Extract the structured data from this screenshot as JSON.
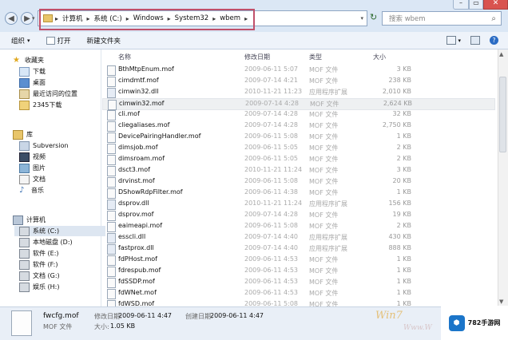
{
  "address": {
    "crumbs": [
      "计算机",
      "系统 (C:)",
      "Windows",
      "System32",
      "wbem"
    ],
    "refresh": "↻"
  },
  "search": {
    "placeholder": "搜索 wbem"
  },
  "toolbar": {
    "organize": "组织",
    "open": "打开",
    "new_folder": "新建文件夹"
  },
  "nav": {
    "favorites": {
      "title": "收藏夹",
      "items": [
        "下载",
        "桌面",
        "最近访问的位置",
        "2345下载"
      ]
    },
    "library": {
      "title": "库",
      "items": [
        "Subversion",
        "视频",
        "图片",
        "文档",
        "音乐"
      ]
    },
    "computer": {
      "title": "计算机",
      "items": [
        "系统 (C:)",
        "本地磁盘 (D:)",
        "软件 (E:)",
        "软件 (F:)",
        "文档 (G:)",
        "娱乐 (H:)"
      ]
    }
  },
  "columns": {
    "name": "名称",
    "date": "修改日期",
    "type": "类型",
    "size": "大小"
  },
  "files": [
    {
      "name": "BthMtpEnum.mof",
      "date": "2009-06-11 5:07",
      "type": "MOF 文件",
      "size": "3 KB"
    },
    {
      "name": "cimdmtf.mof",
      "date": "2009-07-14 4:21",
      "type": "MOF 文件",
      "size": "238 KB"
    },
    {
      "name": "cimwin32.dll",
      "date": "2010-11-21 11:23",
      "type": "应用程序扩展",
      "size": "2,010 KB"
    },
    {
      "name": "cimwin32.mof",
      "date": "2009-07-14 4:28",
      "type": "MOF 文件",
      "size": "2,624 KB"
    },
    {
      "name": "cli.mof",
      "date": "2009-07-14 4:28",
      "type": "MOF 文件",
      "size": "32 KB"
    },
    {
      "name": "cliegaliases.mof",
      "date": "2009-07-14 4:28",
      "type": "MOF 文件",
      "size": "2,750 KB"
    },
    {
      "name": "DevicePairingHandler.mof",
      "date": "2009-06-11 5:08",
      "type": "MOF 文件",
      "size": "1 KB"
    },
    {
      "name": "dimsjob.mof",
      "date": "2009-06-11 5:05",
      "type": "MOF 文件",
      "size": "2 KB"
    },
    {
      "name": "dimsroam.mof",
      "date": "2009-06-11 5:05",
      "type": "MOF 文件",
      "size": "2 KB"
    },
    {
      "name": "dsct3.mof",
      "date": "2010-11-21 11:24",
      "type": "MOF 文件",
      "size": "3 KB"
    },
    {
      "name": "drvinst.mof",
      "date": "2009-06-11 5:08",
      "type": "MOF 文件",
      "size": "20 KB"
    },
    {
      "name": "DShowRdpFilter.mof",
      "date": "2009-06-11 4:38",
      "type": "MOF 文件",
      "size": "1 KB"
    },
    {
      "name": "dsprov.dll",
      "date": "2010-11-21 11:24",
      "type": "应用程序扩展",
      "size": "156 KB"
    },
    {
      "name": "dsprov.mof",
      "date": "2009-07-14 4:28",
      "type": "MOF 文件",
      "size": "19 KB"
    },
    {
      "name": "eaimeapi.mof",
      "date": "2009-06-11 5:08",
      "type": "MOF 文件",
      "size": "2 KB"
    },
    {
      "name": "esscli.dll",
      "date": "2009-07-14 4:40",
      "type": "应用程序扩展",
      "size": "430 KB"
    },
    {
      "name": "fastprox.dll",
      "date": "2009-07-14 4:40",
      "type": "应用程序扩展",
      "size": "888 KB"
    },
    {
      "name": "fdPHost.mof",
      "date": "2009-06-11 4:53",
      "type": "MOF 文件",
      "size": "1 KB"
    },
    {
      "name": "fdrespub.mof",
      "date": "2009-06-11 4:53",
      "type": "MOF 文件",
      "size": "1 KB"
    },
    {
      "name": "fdSSDP.mof",
      "date": "2009-06-11 4:53",
      "type": "MOF 文件",
      "size": "1 KB"
    },
    {
      "name": "fdWNet.mof",
      "date": "2009-06-11 4:53",
      "type": "MOF 文件",
      "size": "1 KB"
    },
    {
      "name": "fdWSD.mof",
      "date": "2009-06-11 5:08",
      "type": "MOF 文件",
      "size": "1 KB"
    }
  ],
  "details": {
    "filename": "fwcfg.mof",
    "modified_label": "修改日期:",
    "modified": "2009-06-11 4:47",
    "created_label": "创建日期:",
    "created": "2009-06-11 4:47",
    "type": "MOF 文件",
    "size_label": "大小:",
    "size": "1.05 KB"
  },
  "logo": {
    "text": "782手游网"
  },
  "watermark": {
    "line1": "Win7",
    "line2": "Www.W"
  },
  "colors": {
    "selection": "#eef0f2",
    "address_highlight": "#c0506a",
    "toolbar_bg": "#eef3fa"
  }
}
